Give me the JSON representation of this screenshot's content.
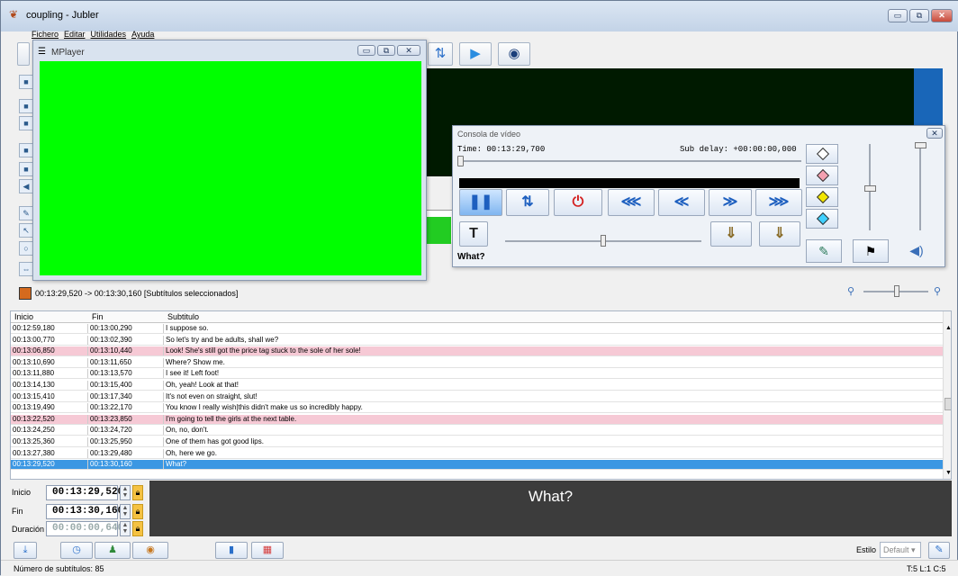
{
  "window": {
    "title": "coupling - Jubler",
    "min_glyph": "▭",
    "max_glyph": "⧉",
    "close_glyph": "✕"
  },
  "menu": [
    {
      "label": "Fichero"
    },
    {
      "label": "Editar"
    },
    {
      "label": "Utilidades"
    },
    {
      "label": "Ayuda"
    }
  ],
  "mplayer": {
    "title": "MPlayer",
    "screen_color": "#00ff00"
  },
  "console": {
    "title": "Consola de vídeo",
    "time_text": "Time: 00:13:29,700",
    "delay_text": "Sub delay: +00:00:00,000",
    "current_subtitle": "What?",
    "close_glyph": "✕",
    "subtitle_button_glyph": "T",
    "pen_colors": [
      "#ffffff",
      "#f4a0b0",
      "#f2e600",
      "#40d0ff"
    ],
    "buttons": [
      {
        "name": "pause-button",
        "glyph": "❚❚"
      },
      {
        "name": "sync-button",
        "glyph": "⇅"
      },
      {
        "name": "stop-button",
        "glyph": "⏻"
      },
      {
        "name": "fast-rewind-button",
        "glyph": "⋘"
      },
      {
        "name": "rewind-button",
        "glyph": "≪"
      },
      {
        "name": "forward-button",
        "glyph": "≫"
      },
      {
        "name": "fast-forward-button",
        "glyph": "⋙"
      }
    ]
  },
  "selection_info": "00:13:29,520 -> 00:13:30,160 [Subtítulos seleccionados]",
  "table": {
    "headers": {
      "start": "Inicio",
      "end": "Fin",
      "text": "Subtitulo"
    },
    "rows": [
      {
        "start": "00:12:59,180",
        "end": "00:13:00,290",
        "text": "I suppose so.",
        "style": ""
      },
      {
        "start": "00:13:00,770",
        "end": "00:13:02,390",
        "text": "So let's try and be adults, shall we?",
        "style": ""
      },
      {
        "start": "00:13:06,850",
        "end": "00:13:10,440",
        "text": "Look! She's still got the price tag stuck to the sole of her sole!",
        "style": "sel-pink"
      },
      {
        "start": "00:13:10,690",
        "end": "00:13:11,650",
        "text": "Where? Show me.",
        "style": ""
      },
      {
        "start": "00:13:11,880",
        "end": "00:13:13,570",
        "text": "I see it! Left foot!",
        "style": ""
      },
      {
        "start": "00:13:14,130",
        "end": "00:13:15,400",
        "text": "Oh, yeah! Look at that!",
        "style": ""
      },
      {
        "start": "00:13:15,410",
        "end": "00:13:17,340",
        "text": "It's not even on straight, slut!",
        "style": ""
      },
      {
        "start": "00:13:19,490",
        "end": "00:13:22,170",
        "text": "You know I really wish|this didn't make us so incredibly happy.",
        "style": ""
      },
      {
        "start": "00:13:22,520",
        "end": "00:13:23,850",
        "text": "I'm going to tell the girls at the next table.",
        "style": "sel-pink"
      },
      {
        "start": "00:13:24,250",
        "end": "00:13:24,720",
        "text": "On, no, don't.",
        "style": ""
      },
      {
        "start": "00:13:25,360",
        "end": "00:13:25,950",
        "text": "One of them has got good lips.",
        "style": ""
      },
      {
        "start": "00:13:27,380",
        "end": "00:13:29,480",
        "text": "Oh, here we go.",
        "style": ""
      },
      {
        "start": "00:13:29,520",
        "end": "00:13:30,160",
        "text": "What?",
        "style": "current"
      }
    ]
  },
  "editor": {
    "start_label": "Inicio",
    "start_value": "00:13:29,520",
    "end_label": "Fin",
    "end_value": "00:13:30,160",
    "duration_label": "Duración",
    "duration_value": "00:00:00,640",
    "preview_text": "What?"
  },
  "style_selector": {
    "label": "Estilo",
    "value": "Default"
  },
  "status": {
    "subtitle_count": "Número de subtítulos: 85",
    "position": "T:5 L:1 C:5"
  },
  "colors": {
    "accent": "#3b97e3",
    "selected_pink": "#f6c9d5",
    "video_green": "#00ff00"
  }
}
